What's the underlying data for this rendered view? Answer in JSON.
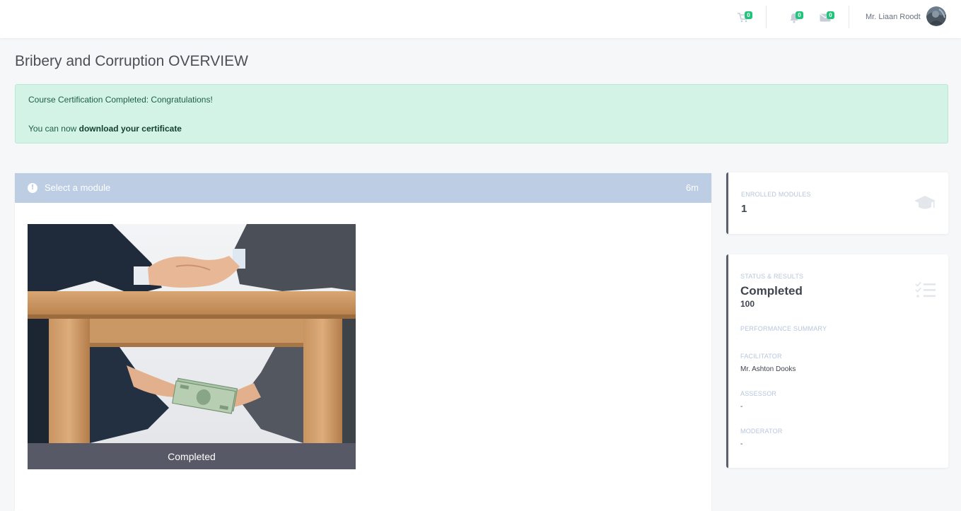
{
  "topbar": {
    "cart_badge": "0",
    "notifications_badge": "0",
    "messages_badge": "0",
    "user_name": "Mr. Liaan Roodt"
  },
  "page": {
    "title": "Bribery and Corruption OVERVIEW"
  },
  "alert": {
    "line1": "Course Certification Completed: Congratulations!",
    "line2_prefix": "You can now ",
    "line2_link": "download your certificate"
  },
  "module_panel": {
    "header_label": "Select a module",
    "duration": "6m",
    "modules": [
      {
        "status": "Completed"
      }
    ]
  },
  "enrolled_card": {
    "label": "ENROLLED MODULES",
    "value": "1",
    "icon": "graduation-cap-icon"
  },
  "status_card": {
    "label": "STATUS & RESULTS",
    "status": "Completed",
    "score": "100",
    "icon": "checklist-icon",
    "performance_label": "PERFORMANCE SUMMARY",
    "facilitator_label": "FACILITATOR",
    "facilitator": "Mr. Ashton Dooks",
    "assessor_label": "ASSESSOR",
    "assessor": "-",
    "moderator_label": "MODERATOR",
    "moderator": "-"
  },
  "colors": {
    "badge_green": "#1ec47a",
    "alert_bg": "#d3f3e6",
    "panel_header": "#bccde4",
    "status_bar": "#575a66"
  }
}
